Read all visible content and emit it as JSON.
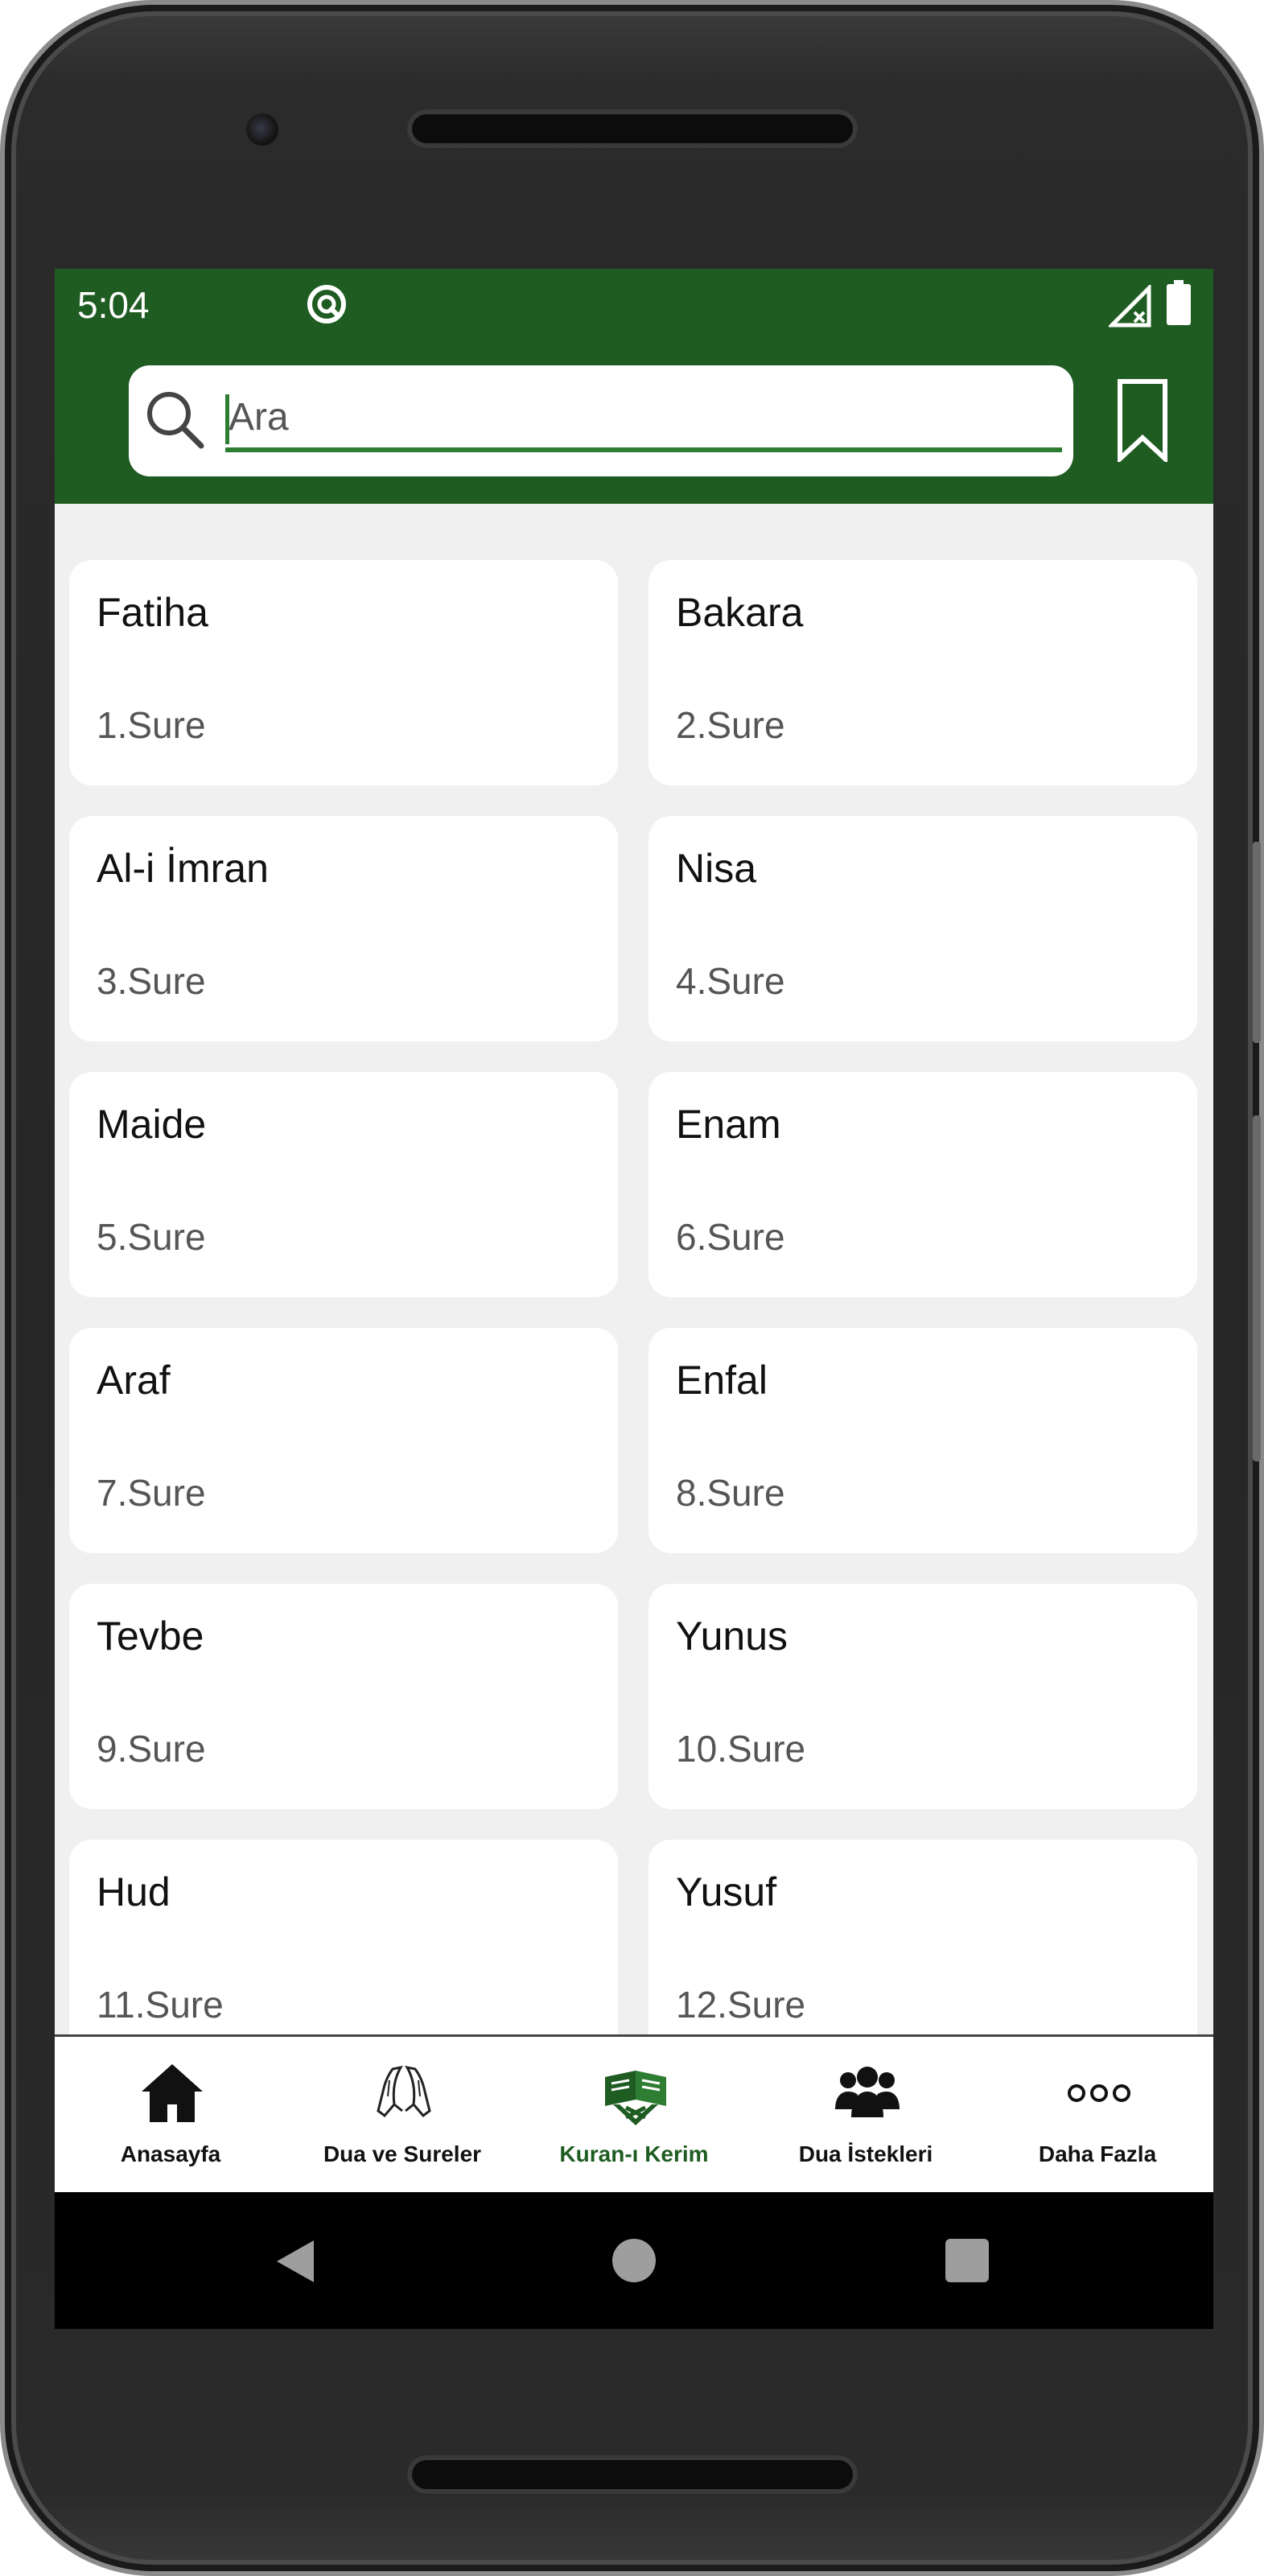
{
  "status_bar": {
    "time": "5:04",
    "app_icon": "app-notification-icon",
    "signal_icon": "signal-no-data-icon",
    "battery_icon": "battery-full-icon"
  },
  "search": {
    "placeholder": "Ara",
    "value": "",
    "icon": "search-icon",
    "bookmark_icon": "bookmark-icon"
  },
  "colors": {
    "primary": "#1f5c22",
    "accent": "#2e7d32",
    "background": "#f0f0f0",
    "card": "#ffffff"
  },
  "surahs": [
    {
      "name": "Fatiha",
      "number": "1.Sure"
    },
    {
      "name": "Bakara",
      "number": "2.Sure"
    },
    {
      "name": "Al-i İmran",
      "number": "3.Sure"
    },
    {
      "name": "Nisa",
      "number": "4.Sure"
    },
    {
      "name": "Maide",
      "number": "5.Sure"
    },
    {
      "name": "Enam",
      "number": "6.Sure"
    },
    {
      "name": "Araf",
      "number": "7.Sure"
    },
    {
      "name": "Enfal",
      "number": "8.Sure"
    },
    {
      "name": "Tevbe",
      "number": "9.Sure"
    },
    {
      "name": "Yunus",
      "number": "10.Sure"
    },
    {
      "name": "Hud",
      "number": "11.Sure"
    },
    {
      "name": "Yusuf",
      "number": "12.Sure"
    }
  ],
  "bottom_nav": {
    "items": [
      {
        "label": "Anasayfa",
        "icon": "home-icon"
      },
      {
        "label": "Dua ve Sureler",
        "icon": "praying-hands-icon"
      },
      {
        "label": "Kuran-ı Kerim",
        "icon": "quran-book-icon",
        "active": true
      },
      {
        "label": "Dua İstekleri",
        "icon": "group-users-icon"
      },
      {
        "label": "Daha Fazla",
        "icon": "more-dots-icon"
      }
    ]
  }
}
